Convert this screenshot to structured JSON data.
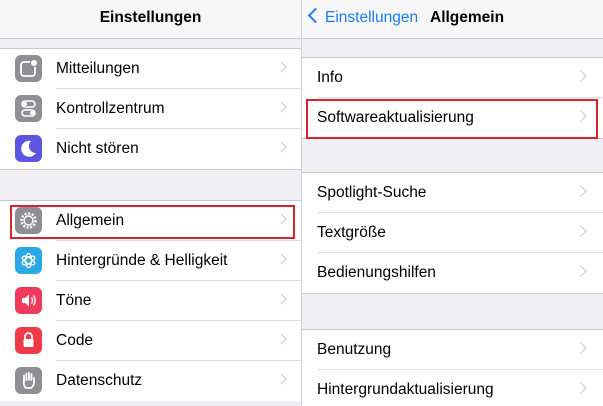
{
  "left": {
    "title": "Einstellungen",
    "group1": [
      {
        "label": "Mitteilungen",
        "icon": "notifications-icon"
      },
      {
        "label": "Kontrollzentrum",
        "icon": "control-center-icon"
      },
      {
        "label": "Nicht stören",
        "icon": "do-not-disturb-icon"
      }
    ],
    "group2": [
      {
        "label": "Allgemein",
        "icon": "gear-icon"
      },
      {
        "label": "Hintergründe & Helligkeit",
        "icon": "wallpaper-icon"
      },
      {
        "label": "Töne",
        "icon": "sound-icon"
      },
      {
        "label": "Code",
        "icon": "lock-icon"
      },
      {
        "label": "Datenschutz",
        "icon": "privacy-hand-icon"
      }
    ]
  },
  "right": {
    "back_label": "Einstellungen",
    "title": "Allgemein",
    "group1": [
      {
        "label": "Info"
      },
      {
        "label": "Softwareaktualisierung"
      }
    ],
    "group2": [
      {
        "label": "Spotlight-Suche"
      },
      {
        "label": "Textgröße"
      },
      {
        "label": "Bedienungshilfen"
      }
    ],
    "group3": [
      {
        "label": "Benutzung"
      },
      {
        "label": "Hintergrundaktualisierung"
      }
    ]
  },
  "colors": {
    "accent": "#1a7cf5",
    "highlight": "#d9232e",
    "notifications_icon_bg": "#8e8e93",
    "control_center_icon_bg": "#8e8e93",
    "do_not_disturb_icon_bg": "#5b55e0",
    "gear_icon_bg": "#8e8e93",
    "wallpaper_icon_bg": "#2aa9e6",
    "sound_icon_bg": "#f03a5c",
    "lock_icon_bg": "#f03a4a",
    "privacy_icon_bg": "#8e8e93"
  }
}
